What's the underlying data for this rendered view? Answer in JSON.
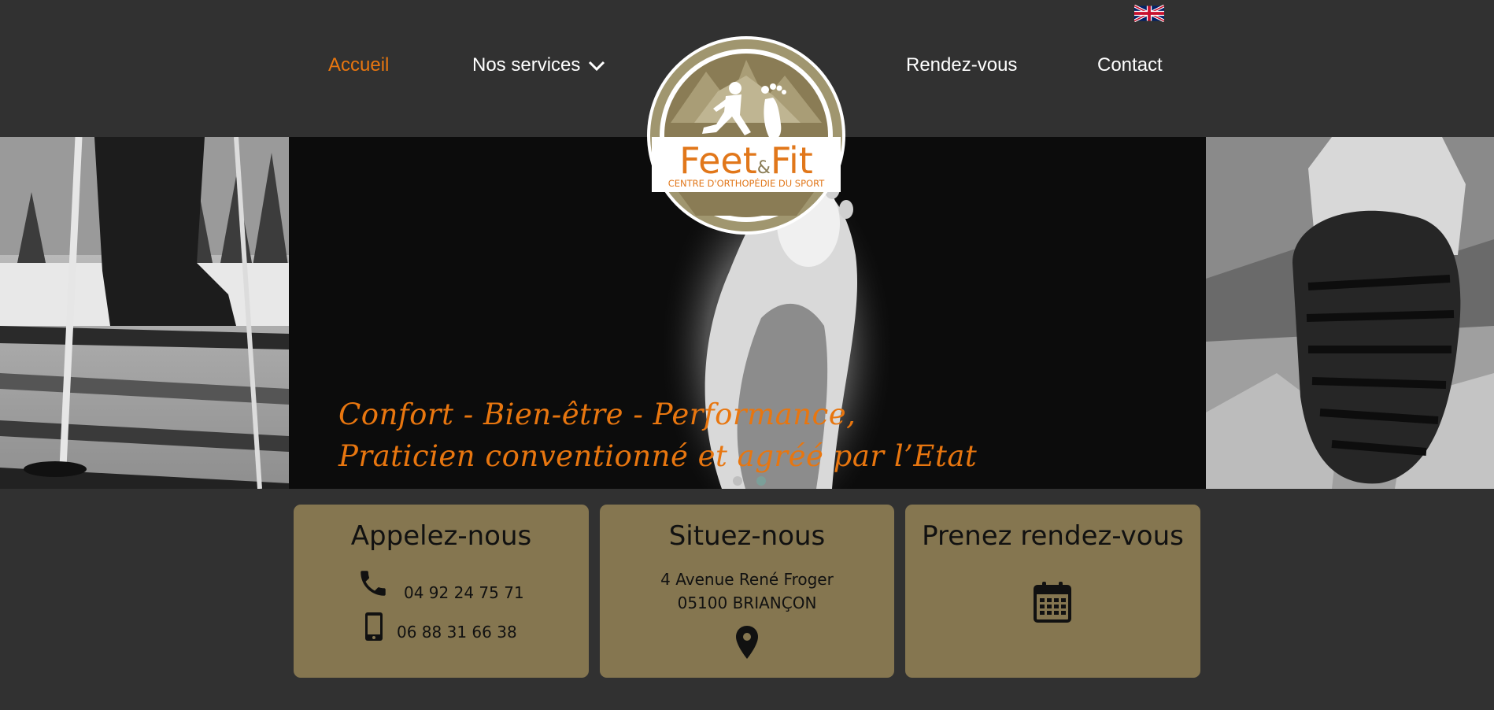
{
  "nav": {
    "language_flag": "uk-flag-icon",
    "items": [
      {
        "label": "Accueil",
        "active": true
      },
      {
        "label": "Nos services",
        "has_dropdown": true
      },
      {
        "label": "Rendez-vous"
      },
      {
        "label": "Contact"
      }
    ]
  },
  "logo": {
    "name": "Feet",
    "amp": "&",
    "name2": "Fit",
    "subtitle": "CENTRE D'ORTHOPÉDIE DU SPORT"
  },
  "hero": {
    "tagline_line1": "Confort - Bien-être - Performance,",
    "tagline_line2": "Praticien conventionné et agréé par l’Etat",
    "slides": 2,
    "active_slide": 1
  },
  "cards": {
    "call": {
      "title": "Appelez-nous",
      "phone": "04 92 24 75 71",
      "mobile": "06 88 31 66 38"
    },
    "locate": {
      "title": "Situez-nous",
      "address_line1": "4 Avenue René Froger",
      "address_line2": "05100 BRIANÇON"
    },
    "appointment": {
      "title": "Prenez rendez-vous"
    }
  },
  "colors": {
    "background": "#313131",
    "accent": "#e8760f",
    "card": "#857650",
    "logo_brown": "#8a7c55"
  }
}
